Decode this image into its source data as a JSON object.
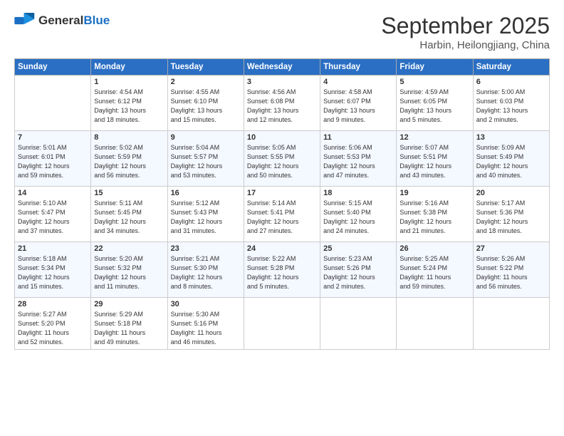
{
  "header": {
    "logo_general": "General",
    "logo_blue": "Blue",
    "month": "September 2025",
    "location": "Harbin, Heilongjiang, China"
  },
  "days_of_week": [
    "Sunday",
    "Monday",
    "Tuesday",
    "Wednesday",
    "Thursday",
    "Friday",
    "Saturday"
  ],
  "weeks": [
    [
      {
        "day": "",
        "info": ""
      },
      {
        "day": "1",
        "info": "Sunrise: 4:54 AM\nSunset: 6:12 PM\nDaylight: 13 hours\nand 18 minutes."
      },
      {
        "day": "2",
        "info": "Sunrise: 4:55 AM\nSunset: 6:10 PM\nDaylight: 13 hours\nand 15 minutes."
      },
      {
        "day": "3",
        "info": "Sunrise: 4:56 AM\nSunset: 6:08 PM\nDaylight: 13 hours\nand 12 minutes."
      },
      {
        "day": "4",
        "info": "Sunrise: 4:58 AM\nSunset: 6:07 PM\nDaylight: 13 hours\nand 9 minutes."
      },
      {
        "day": "5",
        "info": "Sunrise: 4:59 AM\nSunset: 6:05 PM\nDaylight: 13 hours\nand 5 minutes."
      },
      {
        "day": "6",
        "info": "Sunrise: 5:00 AM\nSunset: 6:03 PM\nDaylight: 13 hours\nand 2 minutes."
      }
    ],
    [
      {
        "day": "7",
        "info": "Sunrise: 5:01 AM\nSunset: 6:01 PM\nDaylight: 12 hours\nand 59 minutes."
      },
      {
        "day": "8",
        "info": "Sunrise: 5:02 AM\nSunset: 5:59 PM\nDaylight: 12 hours\nand 56 minutes."
      },
      {
        "day": "9",
        "info": "Sunrise: 5:04 AM\nSunset: 5:57 PM\nDaylight: 12 hours\nand 53 minutes."
      },
      {
        "day": "10",
        "info": "Sunrise: 5:05 AM\nSunset: 5:55 PM\nDaylight: 12 hours\nand 50 minutes."
      },
      {
        "day": "11",
        "info": "Sunrise: 5:06 AM\nSunset: 5:53 PM\nDaylight: 12 hours\nand 47 minutes."
      },
      {
        "day": "12",
        "info": "Sunrise: 5:07 AM\nSunset: 5:51 PM\nDaylight: 12 hours\nand 43 minutes."
      },
      {
        "day": "13",
        "info": "Sunrise: 5:09 AM\nSunset: 5:49 PM\nDaylight: 12 hours\nand 40 minutes."
      }
    ],
    [
      {
        "day": "14",
        "info": "Sunrise: 5:10 AM\nSunset: 5:47 PM\nDaylight: 12 hours\nand 37 minutes."
      },
      {
        "day": "15",
        "info": "Sunrise: 5:11 AM\nSunset: 5:45 PM\nDaylight: 12 hours\nand 34 minutes."
      },
      {
        "day": "16",
        "info": "Sunrise: 5:12 AM\nSunset: 5:43 PM\nDaylight: 12 hours\nand 31 minutes."
      },
      {
        "day": "17",
        "info": "Sunrise: 5:14 AM\nSunset: 5:41 PM\nDaylight: 12 hours\nand 27 minutes."
      },
      {
        "day": "18",
        "info": "Sunrise: 5:15 AM\nSunset: 5:40 PM\nDaylight: 12 hours\nand 24 minutes."
      },
      {
        "day": "19",
        "info": "Sunrise: 5:16 AM\nSunset: 5:38 PM\nDaylight: 12 hours\nand 21 minutes."
      },
      {
        "day": "20",
        "info": "Sunrise: 5:17 AM\nSunset: 5:36 PM\nDaylight: 12 hours\nand 18 minutes."
      }
    ],
    [
      {
        "day": "21",
        "info": "Sunrise: 5:18 AM\nSunset: 5:34 PM\nDaylight: 12 hours\nand 15 minutes."
      },
      {
        "day": "22",
        "info": "Sunrise: 5:20 AM\nSunset: 5:32 PM\nDaylight: 12 hours\nand 11 minutes."
      },
      {
        "day": "23",
        "info": "Sunrise: 5:21 AM\nSunset: 5:30 PM\nDaylight: 12 hours\nand 8 minutes."
      },
      {
        "day": "24",
        "info": "Sunrise: 5:22 AM\nSunset: 5:28 PM\nDaylight: 12 hours\nand 5 minutes."
      },
      {
        "day": "25",
        "info": "Sunrise: 5:23 AM\nSunset: 5:26 PM\nDaylight: 12 hours\nand 2 minutes."
      },
      {
        "day": "26",
        "info": "Sunrise: 5:25 AM\nSunset: 5:24 PM\nDaylight: 11 hours\nand 59 minutes."
      },
      {
        "day": "27",
        "info": "Sunrise: 5:26 AM\nSunset: 5:22 PM\nDaylight: 11 hours\nand 56 minutes."
      }
    ],
    [
      {
        "day": "28",
        "info": "Sunrise: 5:27 AM\nSunset: 5:20 PM\nDaylight: 11 hours\nand 52 minutes."
      },
      {
        "day": "29",
        "info": "Sunrise: 5:29 AM\nSunset: 5:18 PM\nDaylight: 11 hours\nand 49 minutes."
      },
      {
        "day": "30",
        "info": "Sunrise: 5:30 AM\nSunset: 5:16 PM\nDaylight: 11 hours\nand 46 minutes."
      },
      {
        "day": "",
        "info": ""
      },
      {
        "day": "",
        "info": ""
      },
      {
        "day": "",
        "info": ""
      },
      {
        "day": "",
        "info": ""
      }
    ]
  ]
}
